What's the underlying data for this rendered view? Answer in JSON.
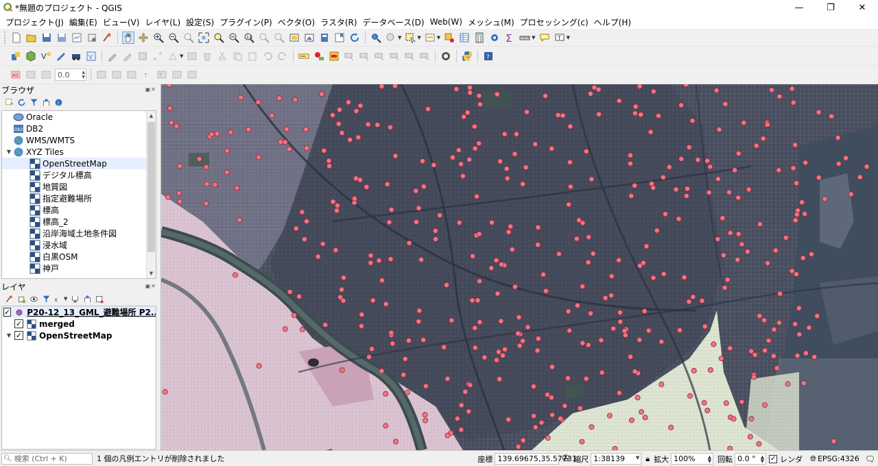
{
  "window": {
    "title": "*無題のプロジェクト - QGIS",
    "controls": {
      "minimize": "—",
      "maximize": "❐",
      "close": "✕"
    }
  },
  "menu": [
    "プロジェクト(J)",
    "編集(E)",
    "ビュー(V)",
    "レイヤ(L)",
    "設定(S)",
    "プラグイン(P)",
    "ベクタ(O)",
    "ラスタ(R)",
    "データベース(D)",
    "Web(W)",
    "メッシュ(M)",
    "プロセッシング(c)",
    "ヘルプ(H)"
  ],
  "toolbar3": {
    "spin_value": "0.0"
  },
  "browser": {
    "title": "ブラウザ",
    "items": [
      {
        "label": "Oracle",
        "icon": "oracle-icon",
        "level": 1
      },
      {
        "label": "DB2",
        "icon": "db2-icon",
        "level": 1
      },
      {
        "label": "WMS/WMTS",
        "icon": "globe-icon",
        "level": 1
      },
      {
        "label": "XYZ Tiles",
        "icon": "globe-icon",
        "level": 0,
        "expanded": true
      },
      {
        "label": "OpenStreetMap",
        "icon": "tile-icon",
        "level": 2,
        "selected": true
      },
      {
        "label": "デジタル標高",
        "icon": "tile-icon",
        "level": 2
      },
      {
        "label": "地質図",
        "icon": "tile-icon",
        "level": 2
      },
      {
        "label": "指定避難場所",
        "icon": "tile-icon",
        "level": 2
      },
      {
        "label": "標高",
        "icon": "tile-icon",
        "level": 2
      },
      {
        "label": "標高_2",
        "icon": "tile-icon",
        "level": 2
      },
      {
        "label": "沿岸海域土地条件図",
        "icon": "tile-icon",
        "level": 2
      },
      {
        "label": "浸水域",
        "icon": "tile-icon",
        "level": 2
      },
      {
        "label": "白黒OSM",
        "icon": "tile-icon",
        "level": 2
      },
      {
        "label": "神戸",
        "icon": "tile-icon",
        "level": 2
      }
    ]
  },
  "layers": {
    "title": "レイヤ",
    "items": [
      {
        "label": "P20-12_13_GML_避難場所 P2...",
        "type": "point",
        "checked": true,
        "selected": true,
        "underline": true
      },
      {
        "label": "merged",
        "type": "raster",
        "checked": true
      },
      {
        "label": "OpenStreetMap",
        "type": "raster",
        "checked": true,
        "expandable": true
      }
    ]
  },
  "statusbar": {
    "search_placeholder": "検索 (Ctrl + K)",
    "message": "1 個の凡例エントリが削除されました",
    "coord_label": "座標",
    "coord_value": "139.69675,35.57731",
    "scale_label": "縮尺",
    "scale_value": "1:38139",
    "magnifier_label": "拡大",
    "magnifier_value": "100%",
    "rotation_label": "回転",
    "rotation_value": "0.0 °",
    "render_label": "レンダ",
    "crs": "EPSG:4326"
  },
  "colors": {
    "point_fill": "#f27384",
    "point_stroke": "#8a2a36"
  }
}
